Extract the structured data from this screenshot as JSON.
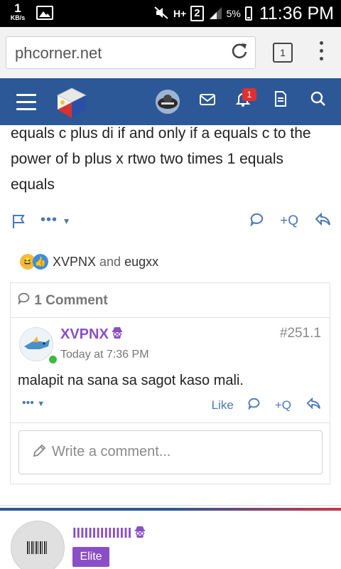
{
  "status_bar": {
    "speed_value": "1",
    "speed_unit": "KB/s",
    "sim": "2",
    "h_plus": "H+",
    "battery": "5%",
    "time": "11:36 PM"
  },
  "browser": {
    "url": "phcorner.net",
    "tabs_count": "1"
  },
  "header": {
    "notification_count": "1"
  },
  "post": {
    "text": "equals c plus di if and only if a equals c to the power of b plus x rtwo two times 1 equals equals",
    "more_label": "•••",
    "quote_label": "+Q"
  },
  "reactions": {
    "user1": "XVPNX",
    "and": "and",
    "user2": "eugxx"
  },
  "comments": {
    "header": "1 Comment",
    "items": [
      {
        "user": "XVPNX",
        "number": "#251.1",
        "time": "Today at 7:36 PM",
        "text": "malapit na sana sa sagot kaso mali.",
        "like_label": "Like",
        "quote_label": "+Q",
        "more_label": "•••"
      }
    ],
    "input_placeholder": "Write a comment..."
  },
  "next_post": {
    "user": "IIIIIIIIIIIIIII",
    "rank": "Elite"
  },
  "colors": {
    "header_blue": "#2c5897",
    "link_blue": "#4a77b4",
    "purple": "#8a4fc7",
    "badge_red": "#e03030",
    "online_green": "#3fb93f"
  }
}
